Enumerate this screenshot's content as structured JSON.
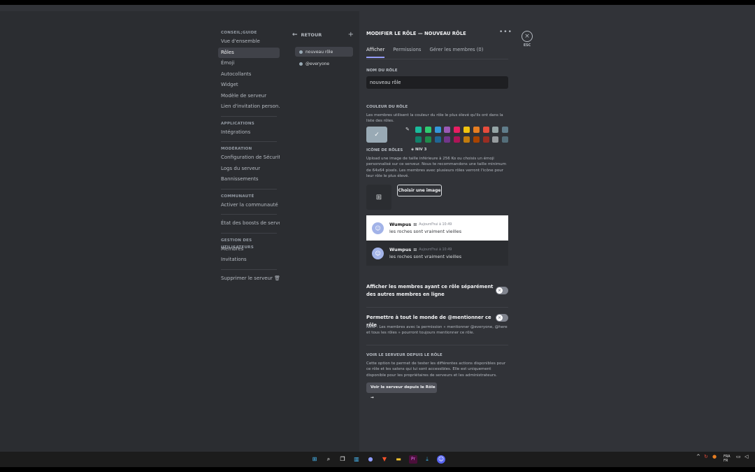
{
  "sidebar": {
    "sections": [
      {
        "title": "CONSEIL;GUIDE",
        "items": [
          "Vue d'ensemble",
          "Rôles",
          "Émoji",
          "Autocollants",
          "Widget",
          "Modèle de serveur",
          "Lien d'invitation person..."
        ]
      },
      {
        "title": "APPLICATIONS",
        "items": [
          "Intégrations"
        ]
      },
      {
        "title": "MODÉRATION",
        "items": [
          "Configuration de Sécurité",
          "Logs du serveur",
          "Bannissements"
        ]
      },
      {
        "title": "COMMUNAUTÉ",
        "items": [
          "Activer la communauté"
        ]
      },
      {
        "title": "",
        "items": [
          "État des boosts de serveur"
        ]
      },
      {
        "title": "GESTION DES UTILISATEURS",
        "items": [
          "Membres",
          "Invitations"
        ]
      }
    ],
    "delete_label": "Supprimer le serveur"
  },
  "rolecol": {
    "back_label": "RETOUR",
    "roles": [
      "nouveau rôle",
      "@everyone"
    ]
  },
  "main": {
    "title": "MODIFIER LE RÔLE — NOUVEAU RÔLE",
    "tabs": [
      "Afficher",
      "Permissions",
      "Gérer les membres (0)"
    ],
    "name_label": "NOM DU RÔLE",
    "name_value": "nouveau rôle",
    "color_label": "COULEUR DU RÔLE",
    "color_desc": "Les membres utilisent la couleur du rôle le plus élevé qu'ils ont dans la liste des rôles.",
    "icon_label": "ICÔNE DE RÔLES",
    "icon_badge": "NIV 3",
    "icon_desc": "Upload une image de taille inférieure à 256 Ko ou choisis un émoji personnalisé sur ce serveur. Nous te recommandons une taille minimum de 64x64 pixels. Les membres avec plusieurs rôles verront l'icône pour leur rôle le plus élevé.",
    "choose_image": "Choisir une image",
    "preview_author": "Wumpus",
    "preview_time": "Aujourd'hui à 10:49",
    "preview_text": "les roches sont vraiment vieilles",
    "toggle1_label": "Afficher les membres ayant ce rôle séparément des autres membres en ligne",
    "toggle2_label_pre": "Permettre à tout le monde de ",
    "toggle2_label_bold": "@mentionner",
    "toggle2_label_post": " ce rôle",
    "toggle2_note": "Note : Les membres avec la permission « mentionner @everyone, @here et tous les rôles » pourront toujours mentionner ce rôle.",
    "view_label": "VOIR LE SERVEUR DEPUIS LE RÔLE",
    "view_desc": "Cette option te permet de tester les différentes actions disponibles pour ce rôle et les salons qui lui sont accessibles. Elle est uniquement disponible pour les propriétaires de serveurs et les administrateurs.",
    "view_button": "Voir le serveur depuis le Rôle →",
    "esc_label": "ESC"
  },
  "swatches": {
    "row1": [
      "#1abc9c",
      "#2ecc71",
      "#3498db",
      "#9b59b6",
      "#e91e63",
      "#f1c40f",
      "#e67e22",
      "#e74c3c",
      "#95a5a6",
      "#607d8b"
    ],
    "row2": [
      "#11806a",
      "#1f8b4c",
      "#206694",
      "#71368a",
      "#ad1457",
      "#c27c0e",
      "#a84300",
      "#992d22",
      "#979c9f",
      "#546e7a"
    ]
  },
  "taskbar": {
    "lang_top": "FRA",
    "lang_bottom": "FR"
  }
}
